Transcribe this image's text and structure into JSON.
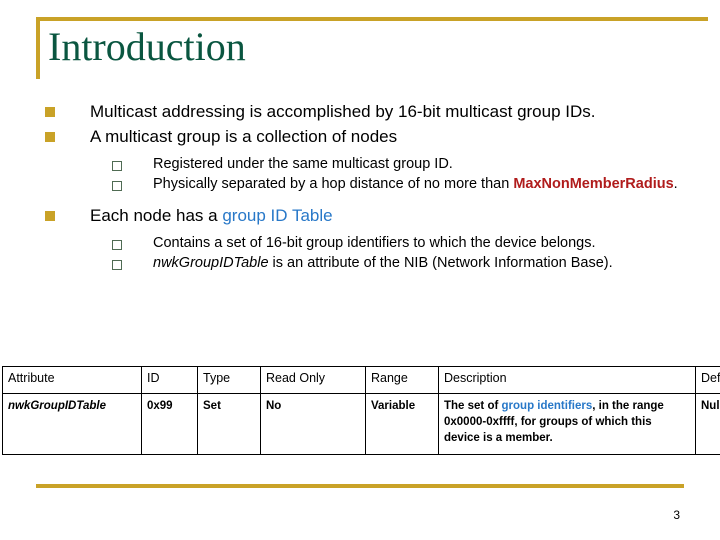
{
  "slide": {
    "title": "Introduction",
    "page_number": "3",
    "accent_gold": "#c9a227",
    "title_green": "#0a5640",
    "accent_red": "#b01c1c",
    "accent_blue": "#2878c8"
  },
  "bullets": {
    "item1": "Multicast addressing is accomplished by 16-bit multicast group IDs.",
    "item2": "A multicast group is a collection of nodes",
    "item2_sub1": "Registered under the same multicast group ID.",
    "item2_sub2_part1": "Physically separated by a hop distance of no more than ",
    "item2_sub2_term": "MaxNonMemberRadius",
    "item2_sub2_part2": ".",
    "item3_part1": "Each node has a ",
    "item3_term": "group ID Table",
    "item3_sub1": "Contains a set of 16-bit group identifiers to which the device belongs.",
    "item3_sub2_term": "nwkGroupIDTable",
    "item3_sub2_rest": " is an attribute of the NIB (Network Information Base)."
  },
  "table": {
    "headers": [
      "Attribute",
      "ID",
      "Type",
      "Read Only",
      "Range",
      "Description",
      "Default"
    ],
    "row": {
      "attribute": "nwkGroupIDTable",
      "id": "0x99",
      "type": "Set",
      "read_only": "No",
      "range": "Variable",
      "description_part1": "The set of ",
      "description_term": "group identifiers",
      "description_part2": ", in the range 0x0000-0xffff, for groups of which this device is a member.",
      "default": "Null Set"
    }
  }
}
